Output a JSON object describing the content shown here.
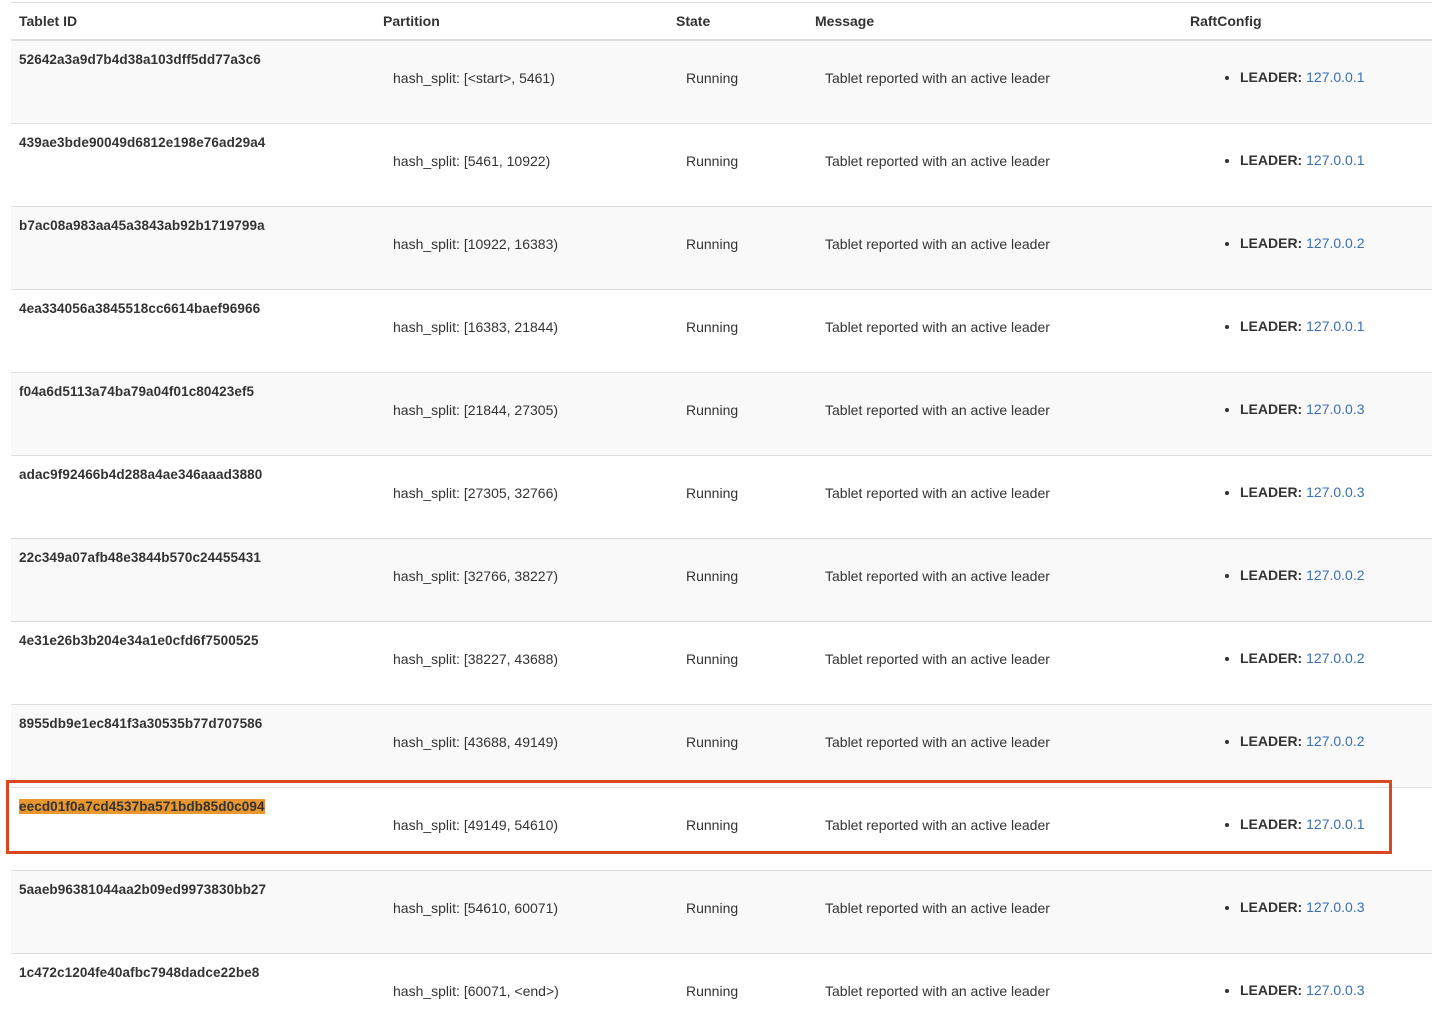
{
  "columns": {
    "tablet_id": "Tablet ID",
    "partition": "Partition",
    "state": "State",
    "message": "Message",
    "raftconfig": "RaftConfig"
  },
  "leader_label": "LEADER:",
  "rows": [
    {
      "tablet_id": "52642a3a9d7b4d38a103dff5dd77a3c6",
      "partition": "hash_split: [<start>, 5461)",
      "state": "Running",
      "message": "Tablet reported with an active leader",
      "leader": "127.0.0.1"
    },
    {
      "tablet_id": "439ae3bde90049d6812e198e76ad29a4",
      "partition": "hash_split: [5461, 10922)",
      "state": "Running",
      "message": "Tablet reported with an active leader",
      "leader": "127.0.0.1"
    },
    {
      "tablet_id": "b7ac08a983aa45a3843ab92b1719799a",
      "partition": "hash_split: [10922, 16383)",
      "state": "Running",
      "message": "Tablet reported with an active leader",
      "leader": "127.0.0.2"
    },
    {
      "tablet_id": "4ea334056a3845518cc6614baef96966",
      "partition": "hash_split: [16383, 21844)",
      "state": "Running",
      "message": "Tablet reported with an active leader",
      "leader": "127.0.0.1"
    },
    {
      "tablet_id": "f04a6d5113a74ba79a04f01c80423ef5",
      "partition": "hash_split: [21844, 27305)",
      "state": "Running",
      "message": "Tablet reported with an active leader",
      "leader": "127.0.0.3"
    },
    {
      "tablet_id": "adac9f92466b4d288a4ae346aaad3880",
      "partition": "hash_split: [27305, 32766)",
      "state": "Running",
      "message": "Tablet reported with an active leader",
      "leader": "127.0.0.3"
    },
    {
      "tablet_id": "22c349a07afb48e3844b570c24455431",
      "partition": "hash_split: [32766, 38227)",
      "state": "Running",
      "message": "Tablet reported with an active leader",
      "leader": "127.0.0.2"
    },
    {
      "tablet_id": "4e31e26b3b204e34a1e0cfd6f7500525",
      "partition": "hash_split: [38227, 43688)",
      "state": "Running",
      "message": "Tablet reported with an active leader",
      "leader": "127.0.0.2"
    },
    {
      "tablet_id": "8955db9e1ec841f3a30535b77d707586",
      "partition": "hash_split: [43688, 49149)",
      "state": "Running",
      "message": "Tablet reported with an active leader",
      "leader": "127.0.0.2"
    },
    {
      "tablet_id": "eecd01f0a7cd4537ba571bdb85d0c094",
      "partition": "hash_split: [49149, 54610)",
      "state": "Running",
      "message": "Tablet reported with an active leader",
      "leader": "127.0.0.1",
      "highlighted": true
    },
    {
      "tablet_id": "5aaeb96381044aa2b09ed9973830bb27",
      "partition": "hash_split: [54610, 60071)",
      "state": "Running",
      "message": "Tablet reported with an active leader",
      "leader": "127.0.0.3"
    },
    {
      "tablet_id": "1c472c1204fe40afbc7948dadce22be8",
      "partition": "hash_split: [60071, <end>)",
      "state": "Running",
      "message": "Tablet reported with an active leader",
      "leader": "127.0.0.3"
    }
  ],
  "colors": {
    "highlight_fill": "#e8962e",
    "annotation_border": "#d9481f",
    "link": "#3a6fb0"
  }
}
